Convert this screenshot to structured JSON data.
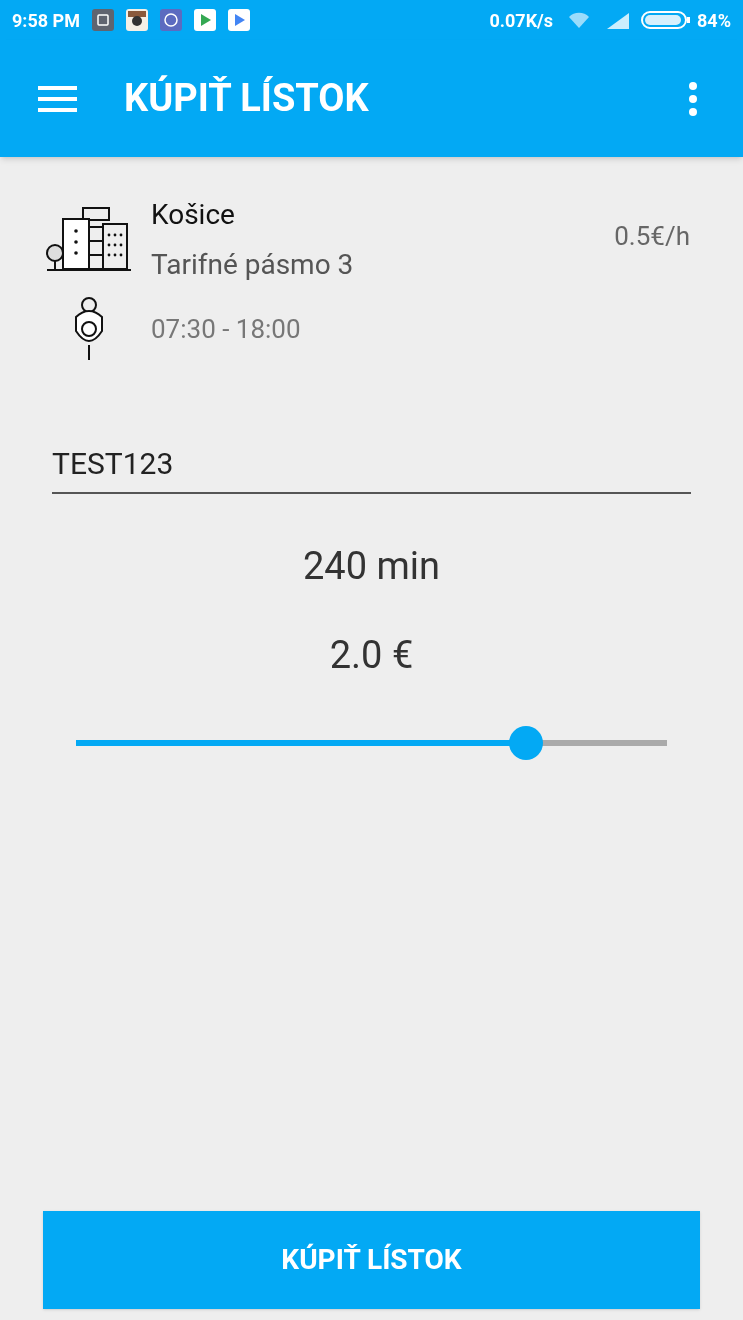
{
  "status_bar": {
    "time": "9:58 PM",
    "speed": "0.07K/s",
    "battery": "84%"
  },
  "app_bar": {
    "title": "KÚPIŤ LÍSTOK"
  },
  "zone": {
    "city": "Košice",
    "zone": "Tarifné pásmo 3",
    "rate": "0.5€/h",
    "hours": "07:30 - 18:00"
  },
  "plate_field": {
    "value": "TEST123"
  },
  "duration": "240 min",
  "price": "2.0 €",
  "slider": {
    "level": 0.762
  },
  "buy_button": {
    "label": "KÚPIŤ LÍSTOK"
  }
}
